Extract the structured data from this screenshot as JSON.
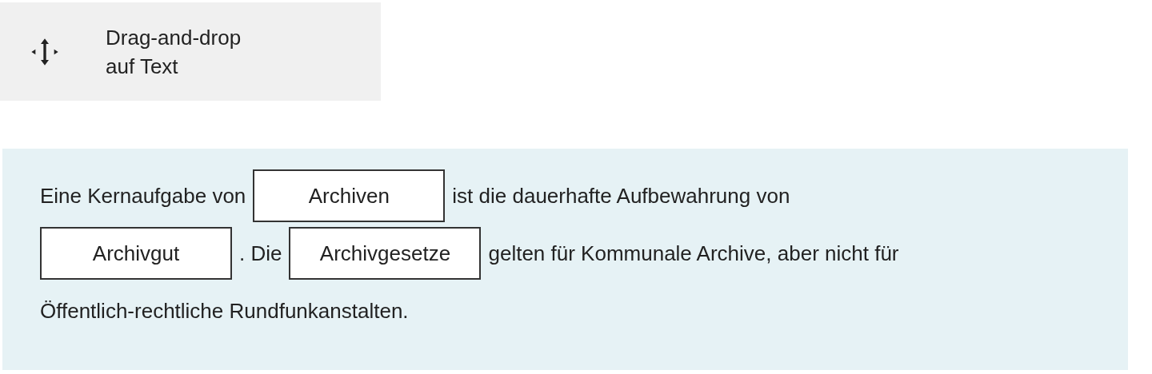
{
  "question_type": {
    "label_lines": [
      "Drag-and-drop",
      "auf Text"
    ]
  },
  "sentence_lines": [
    [
      {
        "kind": "text",
        "text": "Eine Kernaufgabe von"
      },
      {
        "kind": "blank",
        "value": "Archiven"
      },
      {
        "kind": "text",
        "text": "ist die dauerhafte Aufbewahrung von"
      }
    ],
    [
      {
        "kind": "blank",
        "value": "Archivgut"
      },
      {
        "kind": "text",
        "text": ". Die"
      },
      {
        "kind": "blank",
        "value": "Archivgesetze"
      },
      {
        "kind": "text",
        "text": "gelten für Kommunale Archive, aber nicht für"
      }
    ],
    [
      {
        "kind": "text",
        "text": "Öffentlich-rechtliche Rundfunkanstalten."
      }
    ]
  ]
}
